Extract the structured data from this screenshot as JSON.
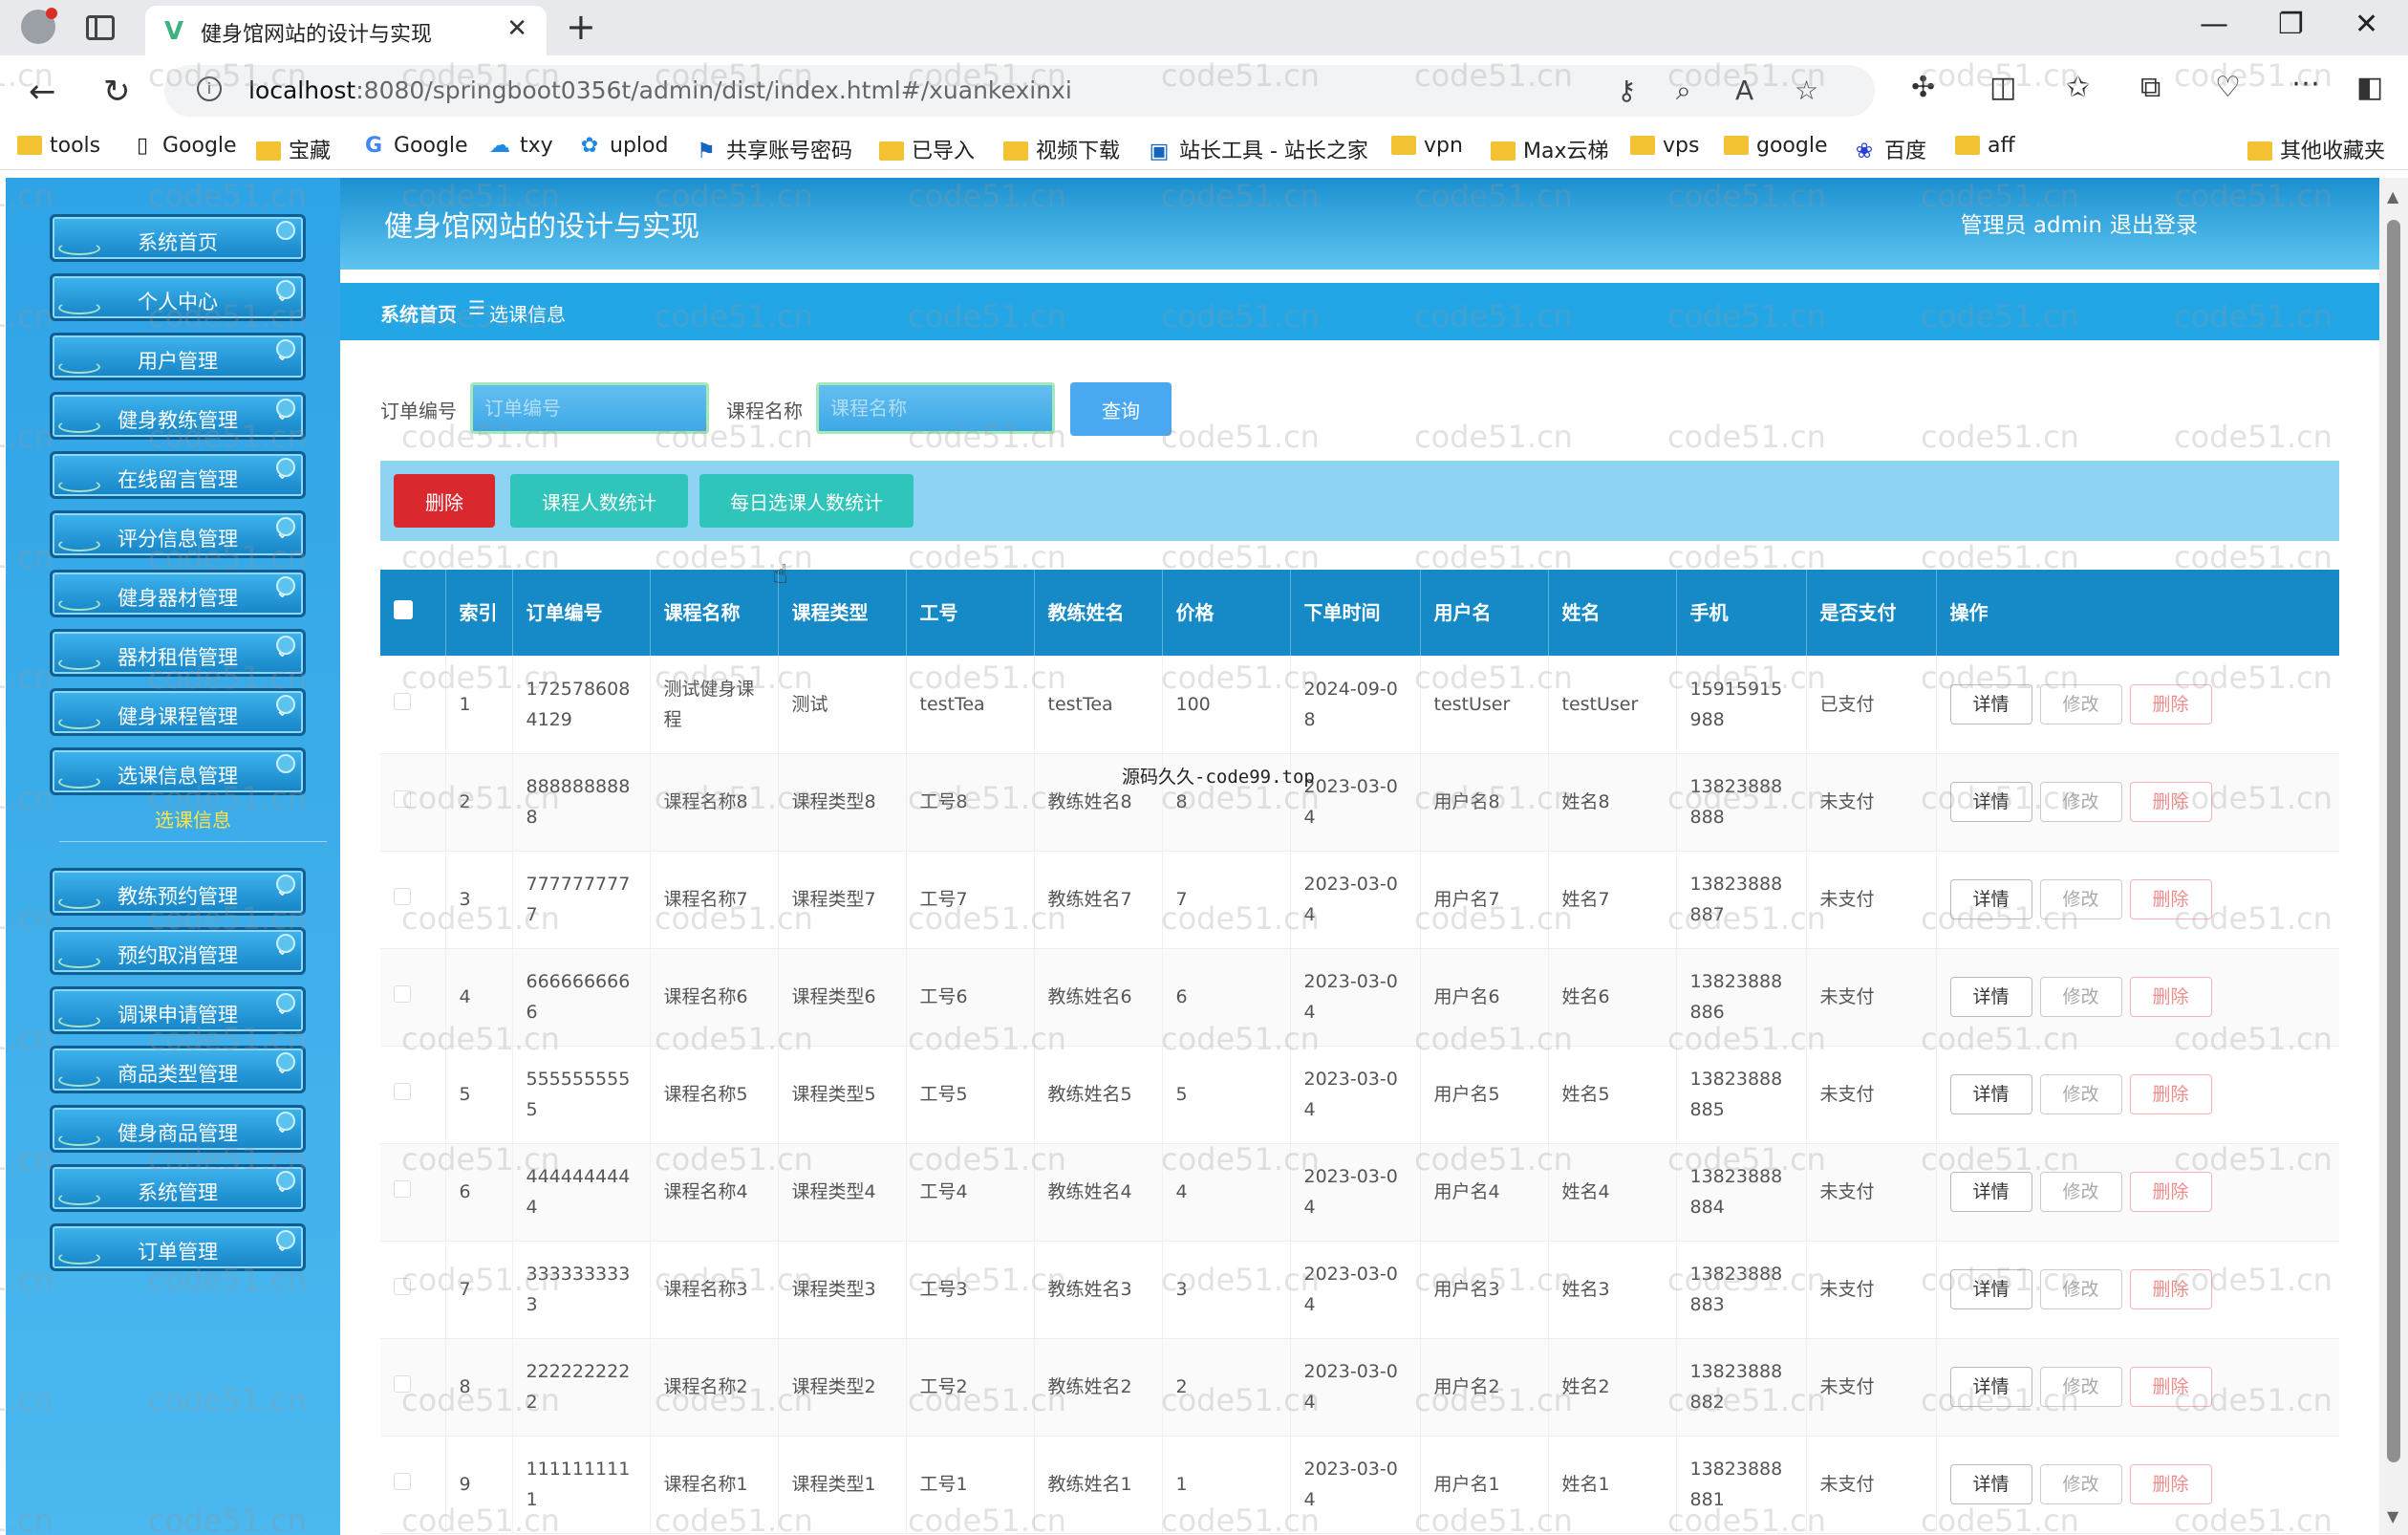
{
  "browser": {
    "tab_title": "健身馆网站的设计与实现",
    "url_host": "localhost",
    "url_rest": ":8080/springboot0356t/admin/dist/index.html#/xuankexinxi",
    "bookmarks": [
      "tools",
      "Google",
      "宝藏",
      "Google",
      "txy",
      "uplod",
      "共享账号密码",
      "已导入",
      "视频下载",
      "站长工具 - 站长之家",
      "vpn",
      "Max云梯",
      "vps",
      "google",
      "百度",
      "aff",
      "其他收藏夹"
    ]
  },
  "app": {
    "title": "健身馆网站的设计与实现",
    "user_label": "管理员 admin",
    "logout": "退出登录"
  },
  "breadcrumb": {
    "home": "系统首页",
    "sep": "☰",
    "current": "选课信息"
  },
  "sidebar": {
    "items": [
      "系统首页",
      "个人中心",
      "用户管理",
      "健身教练管理",
      "在线留言管理",
      "评分信息管理",
      "健身器材管理",
      "器材租借管理",
      "健身课程管理",
      "选课信息管理"
    ],
    "active_sub": "选课信息",
    "items2": [
      "教练预约管理",
      "预约取消管理",
      "调课申请管理",
      "商品类型管理",
      "健身商品管理",
      "系统管理",
      "订单管理"
    ]
  },
  "search": {
    "order_label": "订单编号",
    "order_placeholder": "订单编号",
    "course_label": "课程名称",
    "course_placeholder": "课程名称",
    "query_button": "查询"
  },
  "actions": {
    "delete": "删除",
    "stat_course": "课程人数统计",
    "stat_daily": "每日选课人数统计"
  },
  "table": {
    "headers": [
      "索引",
      "订单编号",
      "课程名称",
      "课程类型",
      "工号",
      "教练姓名",
      "价格",
      "下单时间",
      "用户名",
      "姓名",
      "手机",
      "是否支付",
      "操作"
    ],
    "op_labels": {
      "detail": "详情",
      "edit": "修改",
      "remove": "删除"
    },
    "rows": [
      [
        "1",
        "1725786084129",
        "测试健身课程",
        "测试",
        "testTea",
        "testTea",
        "100",
        "2024-09-08",
        "testUser",
        "testUser",
        "15915915988",
        "已支付"
      ],
      [
        "2",
        "8888888888",
        "课程名称8",
        "课程类型8",
        "工号8",
        "教练姓名8",
        "8",
        "2023-03-04",
        "用户名8",
        "姓名8",
        "13823888888",
        "未支付"
      ],
      [
        "3",
        "7777777777",
        "课程名称7",
        "课程类型7",
        "工号7",
        "教练姓名7",
        "7",
        "2023-03-04",
        "用户名7",
        "姓名7",
        "13823888887",
        "未支付"
      ],
      [
        "4",
        "6666666666",
        "课程名称6",
        "课程类型6",
        "工号6",
        "教练姓名6",
        "6",
        "2023-03-04",
        "用户名6",
        "姓名6",
        "13823888886",
        "未支付"
      ],
      [
        "5",
        "5555555555",
        "课程名称5",
        "课程类型5",
        "工号5",
        "教练姓名5",
        "5",
        "2023-03-04",
        "用户名5",
        "姓名5",
        "13823888885",
        "未支付"
      ],
      [
        "6",
        "4444444444",
        "课程名称4",
        "课程类型4",
        "工号4",
        "教练姓名4",
        "4",
        "2023-03-04",
        "用户名4",
        "姓名4",
        "13823888884",
        "未支付"
      ],
      [
        "7",
        "3333333333",
        "课程名称3",
        "课程类型3",
        "工号3",
        "教练姓名3",
        "3",
        "2023-03-04",
        "用户名3",
        "姓名3",
        "13823888883",
        "未支付"
      ],
      [
        "8",
        "2222222222",
        "课程名称2",
        "课程类型2",
        "工号2",
        "教练姓名2",
        "2",
        "2023-03-04",
        "用户名2",
        "姓名2",
        "13823888882",
        "未支付"
      ],
      [
        "9",
        "1111111111",
        "课程名称1",
        "课程类型1",
        "工号1",
        "教练姓名1",
        "1",
        "2023-03-04",
        "用户名1",
        "姓名1",
        "13823888881",
        "未支付"
      ]
    ]
  },
  "overlay": "源码久久-code99.top",
  "watermark": "code51.cn",
  "colors": {
    "header": "#1b90d0",
    "sidebar": "#2ea3e6",
    "table_head": "#168ac6",
    "danger": "#d9282e",
    "teal": "#2fc5bb"
  }
}
